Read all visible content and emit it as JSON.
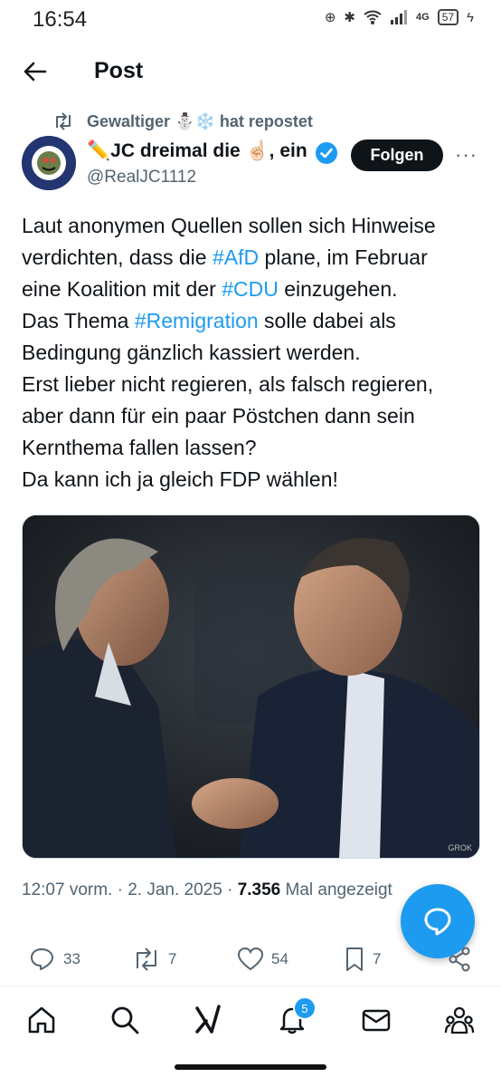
{
  "status_bar": {
    "time": "16:54",
    "network": "4G",
    "battery": "57"
  },
  "header": {
    "title": "Post"
  },
  "repost": {
    "text": "Gewaltiger ⛄❄️ hat repostet"
  },
  "author": {
    "name": "✏️JC dreimal die ☝🏻, ein",
    "handle": "@RealJC1112",
    "follow_label": "Folgen",
    "more": "···"
  },
  "post": {
    "lines": [
      [
        {
          "t": "Laut anonymen Quellen sollen sich Hinweise"
        }
      ],
      [
        {
          "t": "verdichten, dass die "
        },
        {
          "t": "#AfD",
          "tag": true
        },
        {
          "t": " plane, im Februar"
        }
      ],
      [
        {
          "t": "eine Koalition mit der "
        },
        {
          "t": "#CDU",
          "tag": true
        },
        {
          "t": " einzugehen."
        }
      ],
      [
        {
          "t": "Das Thema "
        },
        {
          "t": "#Remigration",
          "tag": true
        },
        {
          "t": " solle dabei als"
        }
      ],
      [
        {
          "t": "Bedingung gänzlich kassiert werden."
        }
      ],
      [
        {
          "t": "Erst lieber nicht regieren, als falsch regieren,"
        }
      ],
      [
        {
          "t": "aber dann für ein paar Pöstchen dann sein"
        }
      ],
      [
        {
          "t": "Kernthema fallen lassen?"
        }
      ],
      [
        {
          "t": "Da kann ich ja gleich FDP wählen!"
        }
      ]
    ],
    "image_watermark": "GROK"
  },
  "meta": {
    "time": "12:07 vorm.",
    "date": "2. Jan. 2025",
    "views": "7.356",
    "views_label": "Mal angezeigt"
  },
  "actions": {
    "replies": "33",
    "reposts": "7",
    "likes": "54",
    "bookmarks": "7"
  },
  "nav": {
    "notification_count": "5"
  },
  "colors": {
    "accent": "#1d9bf0",
    "text": "#0f1419",
    "muted": "#536471"
  }
}
